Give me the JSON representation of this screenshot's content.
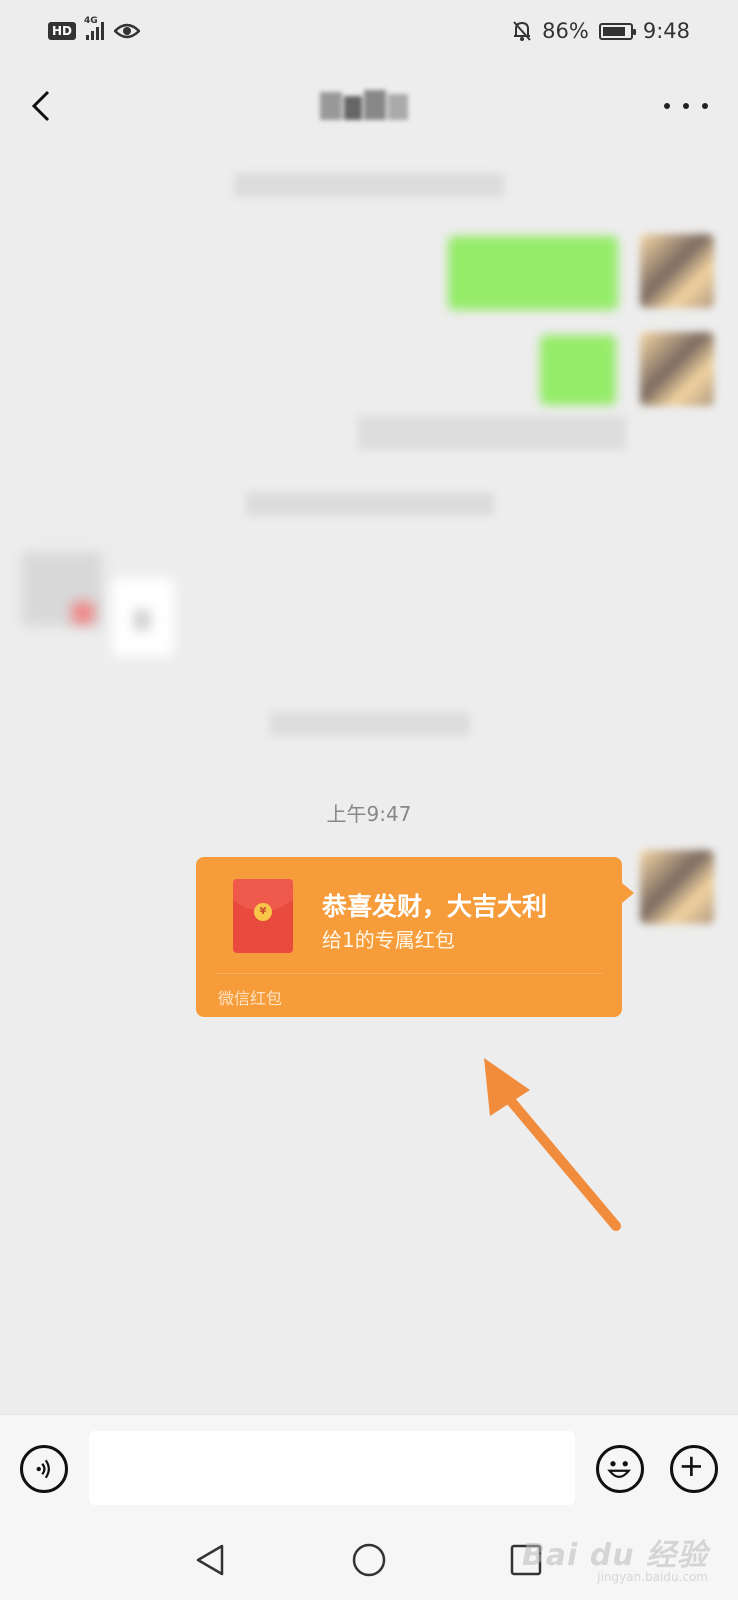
{
  "status_bar": {
    "hd": "HD",
    "network": "4G",
    "battery_percent": "86%",
    "battery_level": 0.86,
    "time": "9:48"
  },
  "chat": {
    "timestamp": "上午9:47",
    "red_packet": {
      "title": "恭喜发财，大吉大利",
      "subtitle": "给1的专属红包",
      "footer": "微信红包",
      "coin_symbol": "¥",
      "bg_color": "#f79c3a",
      "envelope_color": "#e84b3e"
    },
    "annotation_arrow_color": "#f08c3c"
  },
  "input": {
    "value": "",
    "placeholder": ""
  },
  "watermark": {
    "text": "Bai du 经验",
    "sub": "jingyan.baidu.com"
  },
  "icons": {
    "back": "chevron-left-icon",
    "more": "more-dots-icon",
    "voice": "voice-icon",
    "emoji": "emoji-icon",
    "plus": "plus-icon",
    "nav_back": "triangle-back-icon",
    "nav_home": "circle-home-icon",
    "nav_recent": "square-recent-icon"
  }
}
